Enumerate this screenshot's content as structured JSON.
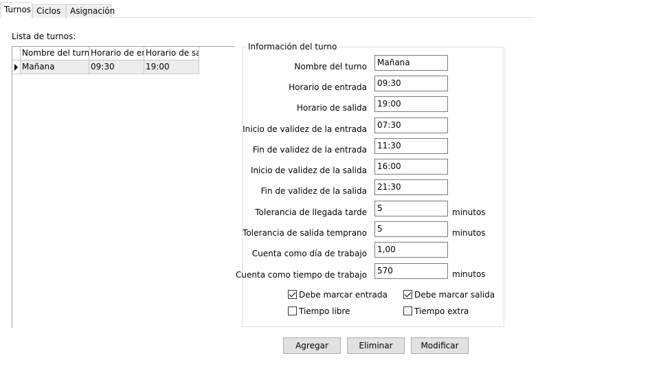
{
  "tabs": [
    "Turnos",
    "Ciclos",
    "Asignación"
  ],
  "list": {
    "label": "Lista de turnos:",
    "columns": [
      "Nombre del turno",
      "Horario de entrada",
      "Horario de salida"
    ],
    "rows": [
      [
        "Mañana",
        "09:30",
        "19:00"
      ]
    ]
  },
  "info": {
    "title": "Información del turno",
    "fields": [
      {
        "label": "Nombre del turno",
        "value": "Mañana",
        "unit": ""
      },
      {
        "label": "Horario de entrada",
        "value": "09:30",
        "unit": ""
      },
      {
        "label": "Horario de salida",
        "value": "19:00",
        "unit": ""
      },
      {
        "label": "Inicio de validez de la entrada",
        "value": "07:30",
        "unit": ""
      },
      {
        "label": "Fin de validez de la entrada",
        "value": "11:30",
        "unit": ""
      },
      {
        "label": "Inicio de validez de la salida",
        "value": "16:00",
        "unit": ""
      },
      {
        "label": "Fin de validez de la salida",
        "value": "21:30",
        "unit": ""
      },
      {
        "label": "Tolerancia de llegada tarde",
        "value": "5",
        "unit": "minutos"
      },
      {
        "label": "Tolerancia de salida temprano",
        "value": "5",
        "unit": "minutos"
      },
      {
        "label": "Cuenta como día de trabajo",
        "value": "1,00",
        "unit": ""
      },
      {
        "label": "Cuenta como tiempo de trabajo",
        "value": "570",
        "unit": "minutos"
      }
    ],
    "checkboxes": [
      {
        "label": "Debe marcar entrada",
        "checked": true
      },
      {
        "label": "Debe marcar salida",
        "checked": true
      },
      {
        "label": "Tiempo libre",
        "checked": false
      },
      {
        "label": "Tiempo extra",
        "checked": false
      }
    ]
  },
  "buttons": {
    "add": "Agregar",
    "delete": "Eliminar",
    "modify": "Modificar"
  }
}
